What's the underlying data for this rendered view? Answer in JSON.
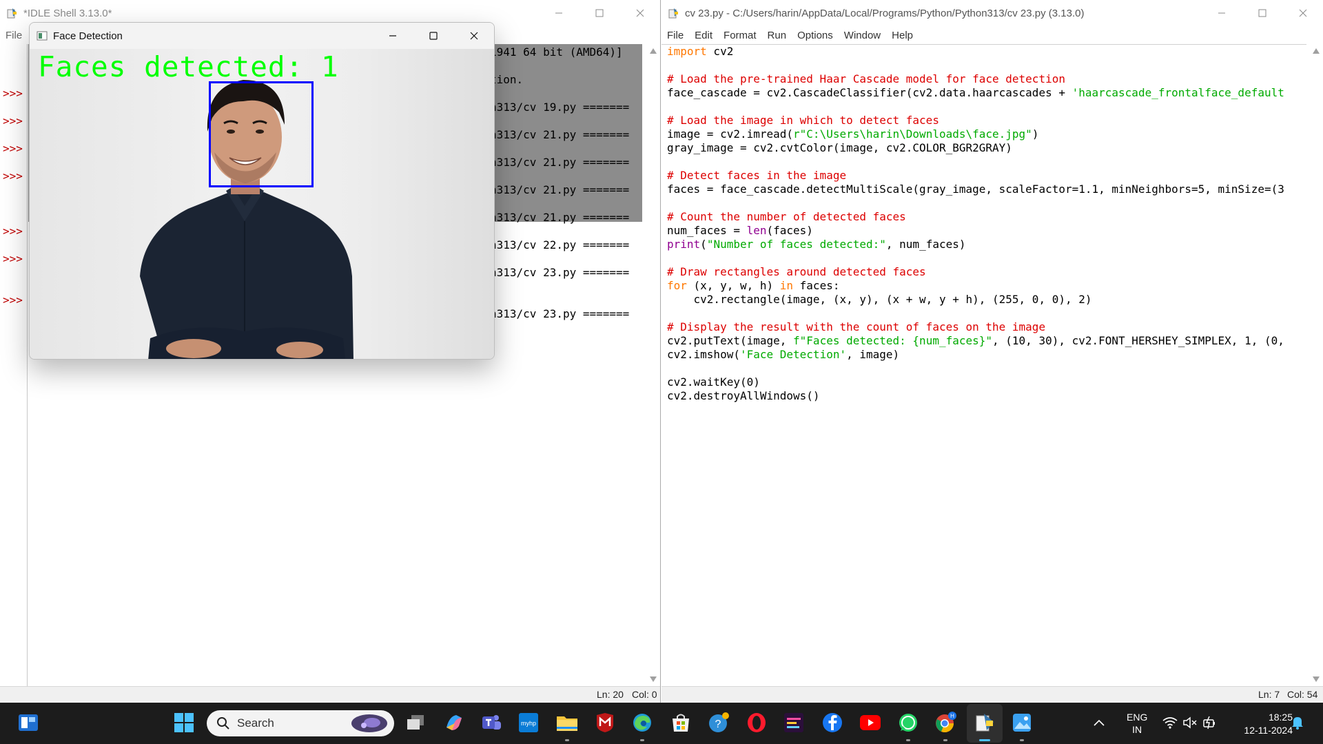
{
  "shell": {
    "title": "*IDLE Shell 3.13.0*",
    "menu": [
      "File"
    ],
    "prompts": [
      ">>>",
      ">>>",
      ">>>",
      ">>>",
      ">>>",
      ">>>",
      ">>>"
    ],
    "lines": [
      "1941 64 bit (AMD64)]",
      "tion.",
      "h313/cv 19.py =======",
      "h313/cv 21.py =======",
      "h313/cv 21.py =======",
      "h313/cv 21.py =======",
      "h313/cv 21.py =======",
      "h313/cv 22.py =======",
      "h313/cv 23.py =======",
      "h313/cv 23.py ======="
    ],
    "status_ln": "Ln: 20",
    "status_col": "Col: 0"
  },
  "editor": {
    "title": "cv 23.py - C:/Users/harin/AppData/Local/Programs/Python/Python313/cv 23.py (3.13.0)",
    "menu": [
      "File",
      "Edit",
      "Format",
      "Run",
      "Options",
      "Window",
      "Help"
    ],
    "code": {
      "l1_kw": "import",
      "l1_rest": " cv2",
      "l3": "# Load the pre-trained Haar Cascade model for face detection",
      "l4_a": "face_cascade = cv2.CascadeClassifier(cv2.data.haarcascades + ",
      "l4_str": "'haarcascade_frontalface_default",
      "l6": "# Load the image in which to detect faces",
      "l7_a": "image = cv2.imread(",
      "l7_str": "r\"C:\\Users\\harin\\Downloads\\face.jpg\"",
      "l7_b": ")",
      "l8": "gray_image = cv2.cvtColor(image, cv2.COLOR_BGR2GRAY)",
      "l10": "# Detect faces in the image",
      "l11": "faces = face_cascade.detectMultiScale(gray_image, scaleFactor=1.1, minNeighbors=5, minSize=(3",
      "l13": "# Count the number of detected faces",
      "l14_a": "num_faces = ",
      "l14_bi": "len",
      "l14_b": "(faces)",
      "l15_bi": "print",
      "l15_a": "(",
      "l15_str": "\"Number of faces detected:\"",
      "l15_b": ", num_faces)",
      "l17": "# Draw rectangles around detected faces",
      "l18_kw1": "for",
      "l18_a": " (x, y, w, h) ",
      "l18_kw2": "in",
      "l18_b": " faces:",
      "l19": "    cv2.rectangle(image, (x, y), (x + w, y + h), (255, 0, 0), 2)",
      "l21": "# Display the result with the count of faces on the image",
      "l22_a": "cv2.putText(image, ",
      "l22_str": "f\"Faces detected: {num_faces}\"",
      "l22_b": ", (10, 30), cv2.FONT_HERSHEY_SIMPLEX, 1, (0,",
      "l23_a": "cv2.imshow(",
      "l23_str": "'Face Detection'",
      "l23_b": ", image)",
      "l25": "cv2.waitKey(0)",
      "l26": "cv2.destroyAllWindows()"
    },
    "status_ln": "Ln: 7",
    "status_col": "Col: 54"
  },
  "face_window": {
    "title": "Face Detection",
    "overlay_text": "Faces detected: 1"
  },
  "taskbar": {
    "search_label": "Search",
    "lang_line1": "ENG",
    "lang_line2": "IN",
    "time": "18:25",
    "date": "12-11-2024",
    "badge_letter": "H"
  },
  "colors": {
    "keyword": "#ff7700",
    "comment": "#dd0000",
    "string": "#00aa00",
    "builtin": "#900090",
    "overlay_green": "#00ff00",
    "face_box_blue": "#0000ff",
    "taskbar_bg": "#1c1c1c"
  }
}
